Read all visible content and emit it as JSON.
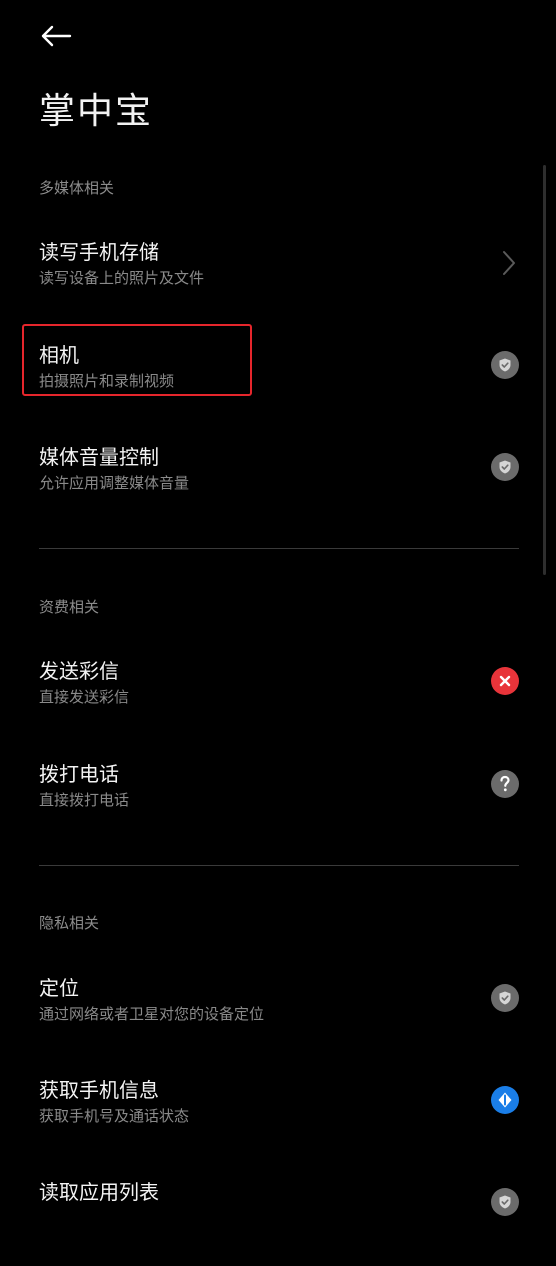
{
  "header": {
    "title": "掌中宝"
  },
  "sections": [
    {
      "label": "多媒体相关",
      "items": [
        {
          "title": "读写手机存储",
          "subtitle": "读写设备上的照片及文件",
          "status": "chevron"
        },
        {
          "title": "相机",
          "subtitle": "拍摄照片和录制视频",
          "status": "allow"
        },
        {
          "title": "媒体音量控制",
          "subtitle": "允许应用调整媒体音量",
          "status": "allow"
        }
      ]
    },
    {
      "label": "资费相关",
      "items": [
        {
          "title": "发送彩信",
          "subtitle": "直接发送彩信",
          "status": "deny"
        },
        {
          "title": "拨打电话",
          "subtitle": "直接拨打电话",
          "status": "ask"
        }
      ]
    },
    {
      "label": "隐私相关",
      "items": [
        {
          "title": "定位",
          "subtitle": "通过网络或者卫星对您的设备定位",
          "status": "allow"
        },
        {
          "title": "获取手机信息",
          "subtitle": "获取手机号及通话状态",
          "status": "info"
        },
        {
          "title": "读取应用列表",
          "subtitle": "",
          "status": "allow"
        }
      ]
    }
  ],
  "colors": {
    "deny": "#e8343a",
    "allow": "#6b6b6b",
    "info": "#1a7ee8",
    "highlight": "#e6262c"
  }
}
